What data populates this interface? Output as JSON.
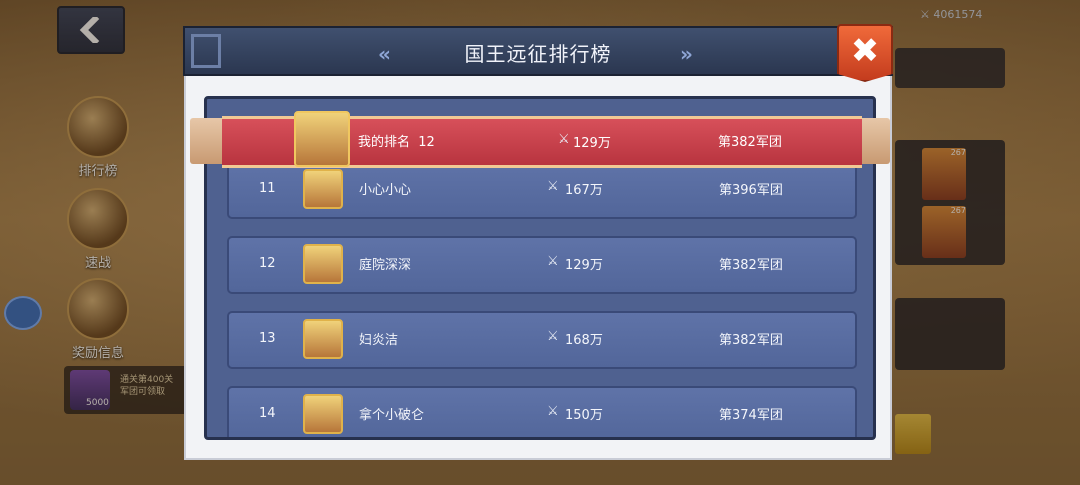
{
  "background": {
    "side_buttons": [
      {
        "label": "排行榜"
      },
      {
        "label": "速战"
      },
      {
        "label": "奖励信息"
      }
    ],
    "reward_strip": {
      "line1": "通关第400关",
      "line2": "军团可领取",
      "count": "5000"
    },
    "top_power": "4061574",
    "right_cards": [
      {
        "level": "267"
      },
      {
        "level": "267"
      }
    ]
  },
  "dialog": {
    "title": "国王远征排行榜",
    "close_symbol": "✖"
  },
  "my_rank": {
    "label": "我的排名",
    "rank": "12",
    "power": "129万",
    "legion": "第382军团"
  },
  "rows": [
    {
      "rank": "11",
      "name": "小心小心",
      "power": "167万",
      "legion": "第396军团"
    },
    {
      "rank": "12",
      "name": "庭院深深",
      "power": "129万",
      "legion": "第382军团"
    },
    {
      "rank": "13",
      "name": "妇炎洁",
      "power": "168万",
      "legion": "第382军团"
    },
    {
      "rank": "14",
      "name": "拿个小破仑",
      "power": "150万",
      "legion": "第374军团"
    }
  ],
  "icons": {
    "swords": "⚔",
    "back": "chevron-left-icon"
  },
  "colors": {
    "ribbon": "#c63f49",
    "row": "#5a6ea3",
    "close": "#e4552d"
  }
}
